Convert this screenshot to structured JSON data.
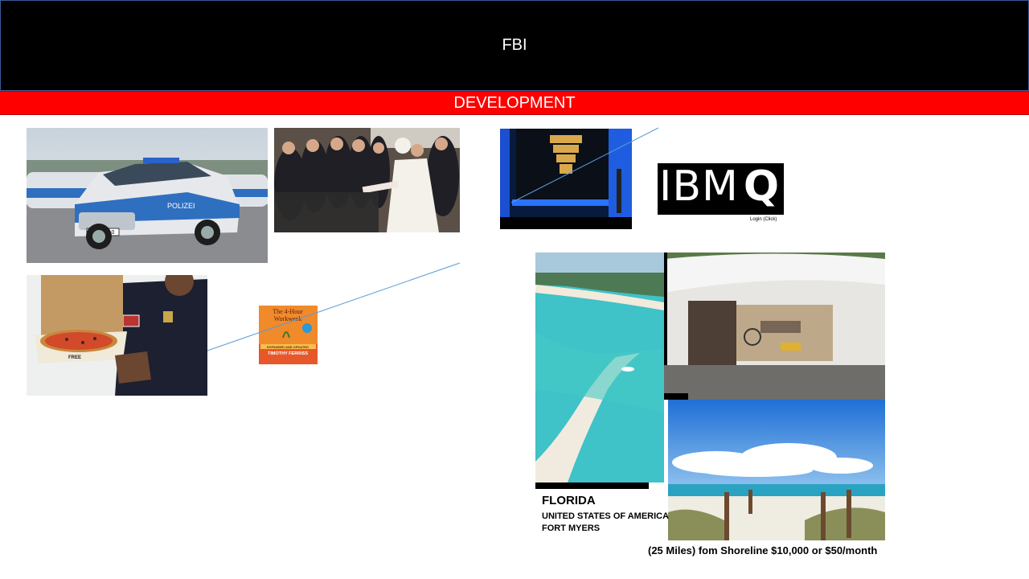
{
  "header": {
    "title": "FBI"
  },
  "banner": {
    "title": "DEVELOPMENT"
  },
  "images": {
    "police_car": {
      "plate": "B·BS 110",
      "label": "POLIZEI"
    },
    "pizza_officer": {
      "box_label": "FREE"
    },
    "book": {
      "title_line1": "The 4-Hour",
      "title_line2": "Workweek",
      "band": "EXPANDED AND UPDATED",
      "author": "TIMOTHY FERRISS"
    }
  },
  "ibm": {
    "logo_text": "IBM",
    "logo_q": "Q",
    "login": "Login (Click)"
  },
  "florida": {
    "title": "FLORIDA",
    "country": "UNITED STATES OF AMERICA",
    "city": "FORT MYERS",
    "price": "(25 Miles) fom Shoreline $10,000 or $50/month"
  },
  "colors": {
    "header": "#000000",
    "banner": "#ff0000",
    "connector": "#5b9bd5"
  }
}
